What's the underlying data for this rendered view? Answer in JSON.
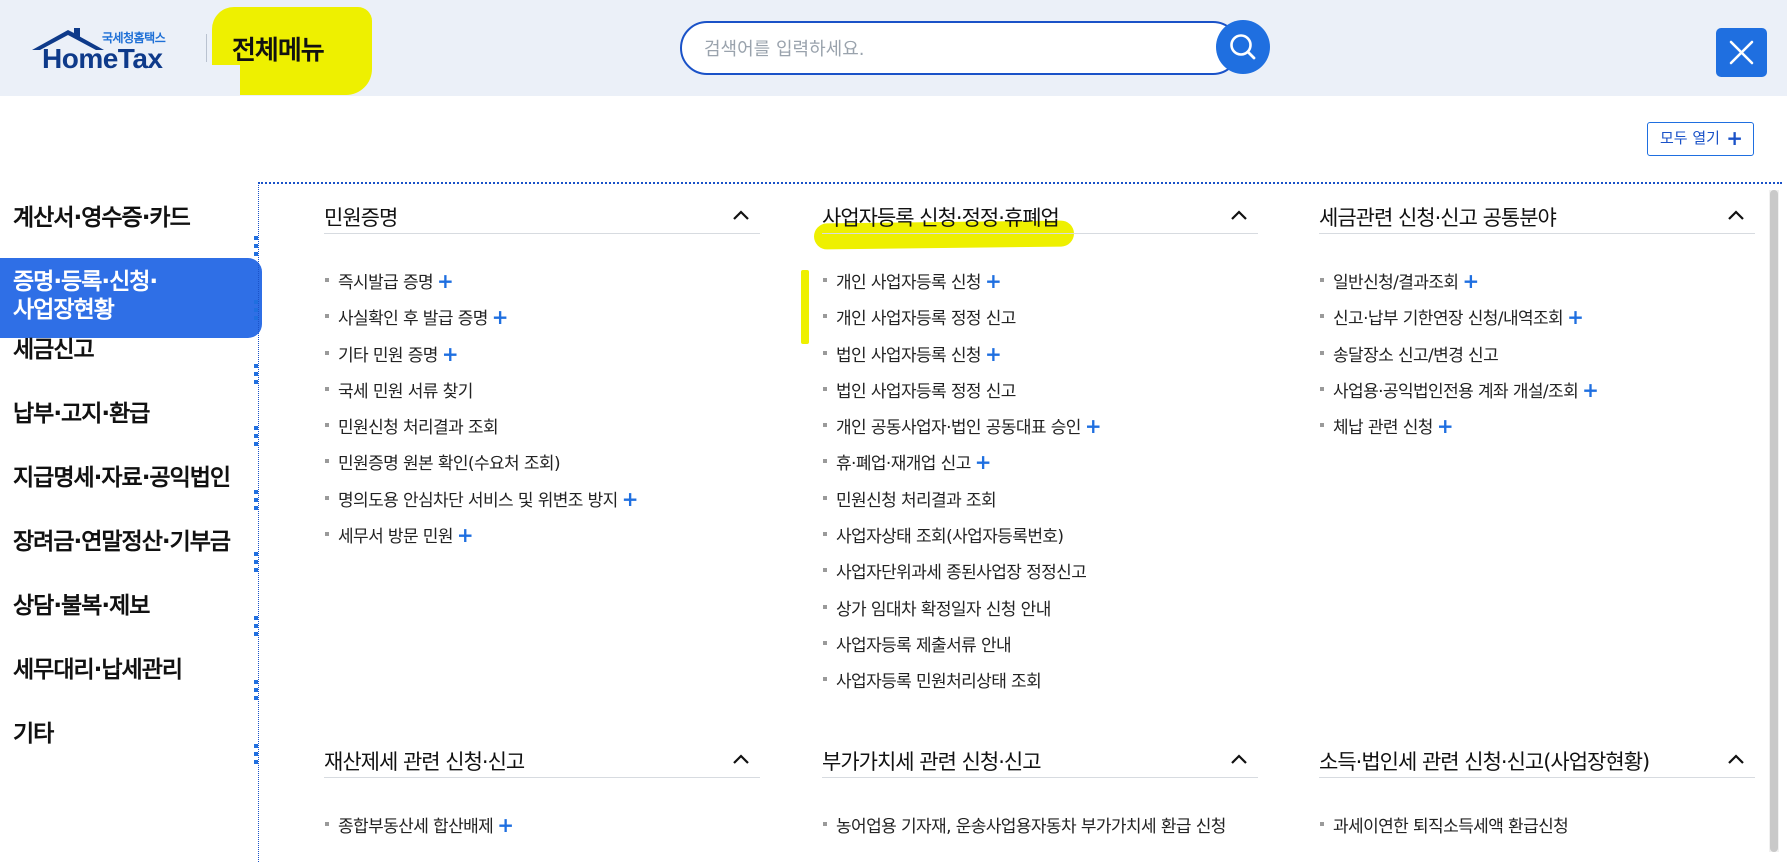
{
  "header": {
    "logo_small": "국세청홈택스",
    "logo_main": "HomeTax",
    "menu_title": "전체메뉴",
    "search_placeholder": "검색어를 입력하세요."
  },
  "colors": {
    "accent": "#1f6fe0",
    "highlight": "#eef000",
    "header_bg": "#ebf0f8",
    "active_nav": "#2f6fe6"
  },
  "expand_all_label": "모두 열기",
  "nav": [
    "계산서·영수증·카드",
    "증명·등록·신청·\n사업장현황",
    "세금신고",
    "납부·고지·환급",
    "지급명세·자료·공익법인",
    "장려금·연말정산·기부금",
    "상담·불복·제보",
    "세무대리·납세관리",
    "기타"
  ],
  "sections": [
    {
      "title": "민원증명",
      "items": [
        {
          "label": "즉시발급 증명",
          "plus": true
        },
        {
          "label": "사실확인 후 발급 증명",
          "plus": true
        },
        {
          "label": "기타 민원 증명",
          "plus": true
        },
        {
          "label": "국세 민원 서류 찾기",
          "plus": false
        },
        {
          "label": "민원신청 처리결과 조회",
          "plus": false
        },
        {
          "label": "민원증명 원본 확인(수요처 조회)",
          "plus": false
        },
        {
          "label": "명의도용 안심차단 서비스 및 위변조 방지",
          "plus": true
        },
        {
          "label": "세무서 방문 민원",
          "plus": true
        }
      ]
    },
    {
      "title": "사업자등록 신청·정정·휴폐업",
      "items": [
        {
          "label": "개인 사업자등록 신청",
          "plus": true
        },
        {
          "label": "개인 사업자등록 정정 신고",
          "plus": false
        },
        {
          "label": "법인 사업자등록 신청",
          "plus": true
        },
        {
          "label": "법인 사업자등록 정정 신고",
          "plus": false
        },
        {
          "label": "개인 공동사업자·법인 공동대표 승인",
          "plus": true
        },
        {
          "label": "휴·폐업·재개업 신고",
          "plus": true
        },
        {
          "label": "민원신청 처리결과 조회",
          "plus": false
        },
        {
          "label": "사업자상태 조회(사업자등록번호)",
          "plus": false
        },
        {
          "label": "사업자단위과세 종된사업장 정정신고",
          "plus": false
        },
        {
          "label": "상가 임대차 확정일자 신청 안내",
          "plus": false
        },
        {
          "label": "사업자등록 제출서류 안내",
          "plus": false
        },
        {
          "label": "사업자등록 민원처리상태 조회",
          "plus": false
        }
      ]
    },
    {
      "title": "세금관련 신청·신고 공통분야",
      "items": [
        {
          "label": "일반신청/결과조회",
          "plus": true
        },
        {
          "label": "신고·납부 기한연장 신청/내역조회",
          "plus": true
        },
        {
          "label": "송달장소 신고/변경 신고",
          "plus": false
        },
        {
          "label": "사업용·공익법인전용 계좌 개설/조회",
          "plus": true
        },
        {
          "label": "체납 관련 신청",
          "plus": true
        }
      ]
    },
    {
      "title": "재산제세 관련 신청·신고",
      "items": [
        {
          "label": "종합부동산세 합산배제",
          "plus": true
        }
      ]
    },
    {
      "title": "부가가치세 관련 신청·신고",
      "items": [
        {
          "label": "농어업용 기자재, 운송사업용자동차 부가가치세 환급 신청",
          "plus": false
        }
      ]
    },
    {
      "title": "소득·법인세 관련 신청·신고(사업장현황)",
      "items": [
        {
          "label": "과세이연한 퇴직소득세액 환급신청",
          "plus": false
        }
      ]
    }
  ]
}
